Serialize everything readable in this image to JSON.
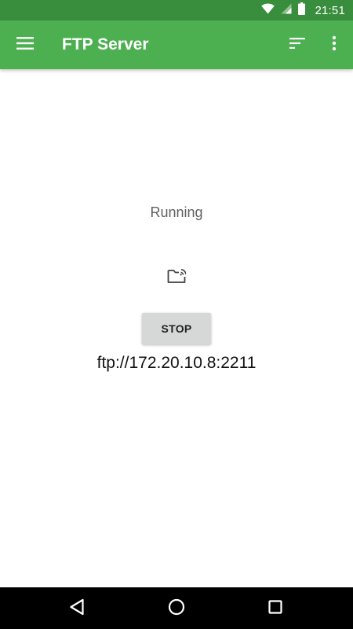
{
  "status_bar": {
    "time": "21:51",
    "icons": [
      "wifi-icon",
      "cellular-signal-icon",
      "battery-icon"
    ],
    "color": "#388e3c"
  },
  "app_bar": {
    "title": "FTP Server",
    "color": "#4caf50",
    "icons": [
      "hamburger-menu-icon",
      "sort-icon",
      "more-vert-icon"
    ]
  },
  "server": {
    "status": "Running",
    "status_icon": "folder-wireless-icon",
    "stop_label": "STOP",
    "url": "ftp://172.20.10.8:2211"
  },
  "nav_bar": {
    "icons": [
      "back-icon",
      "home-icon",
      "recent-apps-icon"
    ]
  }
}
